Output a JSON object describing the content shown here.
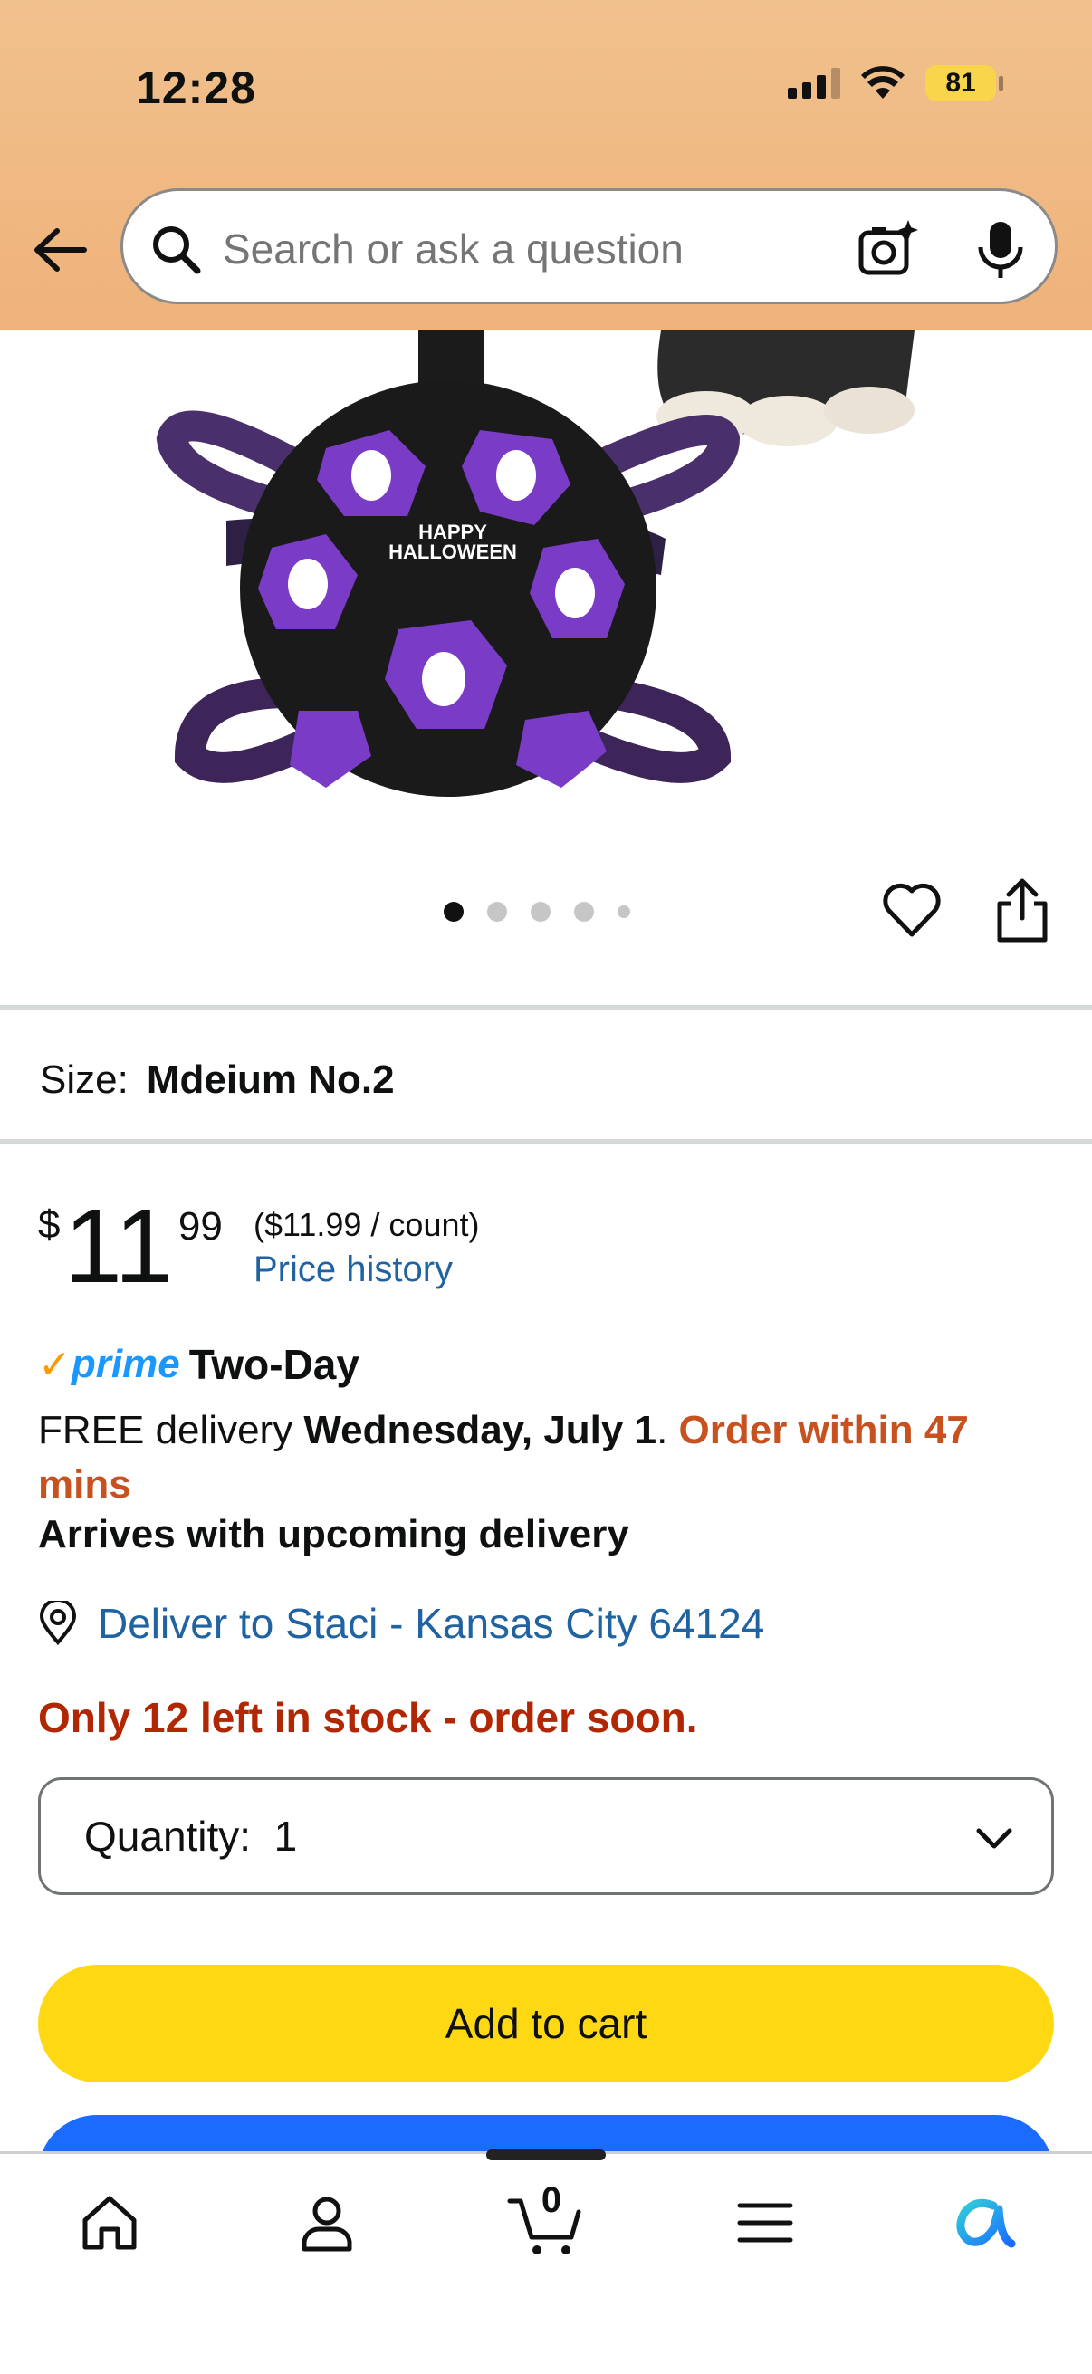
{
  "status_bar": {
    "time": "12:28",
    "battery": "81",
    "signal_icon": "cellular-signal-icon",
    "wifi_icon": "wifi-icon"
  },
  "header": {
    "back_icon": "back-arrow-icon",
    "search_placeholder": "Search or ask a question",
    "camera_icon": "camera-search-icon",
    "mic_icon": "microphone-icon",
    "background_color": "#efb27a"
  },
  "product": {
    "image": "purple-halloween-dog-soccer-ball-image",
    "image_dots": 5,
    "active_image": 1,
    "wishlist_icon": "heart-icon",
    "share_icon": "share-icon"
  },
  "size": {
    "label": "Size:",
    "value": "Mdeium No.2"
  },
  "price": {
    "symbol": "$",
    "whole": "11",
    "fraction": "99",
    "unit_price": "($11.99 / count)",
    "history_link": "Price history"
  },
  "delivery": {
    "prime_word": "prime",
    "speed": "Two-Day",
    "free_prefix": "FREE delivery ",
    "date": "Wednesday, July 1",
    "separator": ". ",
    "urgency": "Order within 47 mins",
    "arrives": "Arrives with upcoming delivery",
    "deliver_to": "Deliver to Staci - Kansas City 64124",
    "stock": "Only 12 left in stock - order soon."
  },
  "quantity": {
    "label": "Quantity:",
    "value": "1"
  },
  "actions": {
    "add_to_cart": "Add to cart",
    "accent_yellow": "#ffd814",
    "accent_blue": "#1a6bff"
  },
  "bottom_nav": {
    "items": [
      "home-icon",
      "account-icon",
      "cart-icon",
      "menu-icon",
      "rufus-icon"
    ],
    "cart_count": "0"
  }
}
